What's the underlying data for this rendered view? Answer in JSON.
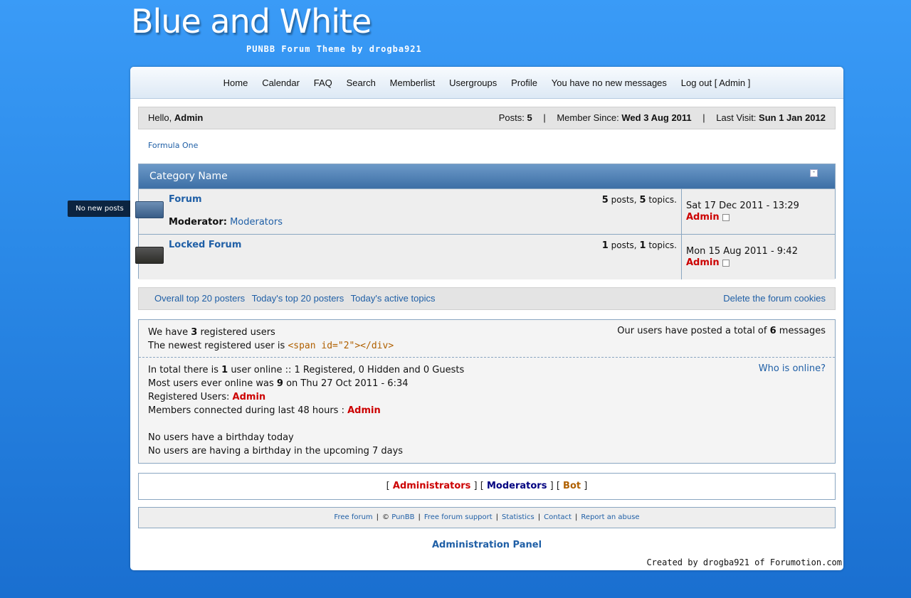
{
  "logo": {
    "title": "Blue and White",
    "subtitle": "PUNBB Forum Theme by drogba921"
  },
  "nav": [
    "Home",
    "Calendar",
    "FAQ",
    "Search",
    "Memberlist",
    "Usergroups",
    "Profile",
    "You have no new messages",
    "Log out [ Admin ]"
  ],
  "userbar": {
    "hello": "Hello,",
    "username": "Admin",
    "posts_label": "Posts:",
    "posts": "5",
    "since_label": "Member Since:",
    "since": "Wed 3 Aug 2011",
    "visit_label": "Last Visit:",
    "visit": "Sun 1 Jan 2012"
  },
  "breadcrumb": "Formula One",
  "category": {
    "name": "Category Name",
    "minimize": "-",
    "tooltip": "No new posts",
    "forums": [
      {
        "title": "Forum",
        "stats_posts": "5",
        "stats_posts_label": "posts,",
        "stats_topics": "5",
        "stats_topics_label": "topics.",
        "mod_label": "Moderator:",
        "mod": "Moderators",
        "last_date": "Sat 17 Dec 2011 - 13:29",
        "last_user": "Admin"
      },
      {
        "title": "Locked Forum",
        "stats_posts": "1",
        "stats_posts_label": "posts,",
        "stats_topics": "1",
        "stats_topics_label": "topics.",
        "last_date": "Mon 15 Aug 2011 - 9:42",
        "last_user": "Admin"
      }
    ]
  },
  "links": {
    "left": [
      "Overall top 20 posters",
      "Today's top 20 posters",
      "Today's active topics"
    ],
    "right": "Delete the forum cookies"
  },
  "stats": {
    "reg_pre": "We have",
    "reg_count": "3",
    "reg_post": "registered users",
    "newest_pre": "The newest registered user is",
    "newest_code": "<span id=\"2\"></div>",
    "total_pre": "Our users have posted a total of",
    "total_count": "6",
    "total_post": "messages",
    "online_pre": "In total there is",
    "online_count": "1",
    "online_post": "user online :: 1 Registered, 0 Hidden and 0 Guests",
    "most_pre": "Most users ever online was",
    "most_count": "9",
    "most_post": "on Thu 27 Oct 2011 - 6:34",
    "registered_label": "Registered Users:",
    "registered_user": "Admin",
    "connected_label": "Members connected during last 48 hours :",
    "connected_user": "Admin",
    "birthday_today": "No users have a birthday today",
    "birthday_upcoming": "No users are having a birthday in the upcoming 7 days",
    "who_online": "Who is online?"
  },
  "legend": {
    "open": "[",
    "close": "]",
    "admins": "Administrators",
    "mods": "Moderators",
    "bot": "Bot"
  },
  "footer": {
    "items": [
      "Free forum",
      "PunBB",
      "Free forum support",
      "Statistics",
      "Contact",
      "Report an abuse"
    ],
    "copy": "©"
  },
  "admin_panel": "Administration Panel",
  "created_by": "Created by drogba921 of Forumotion.com"
}
